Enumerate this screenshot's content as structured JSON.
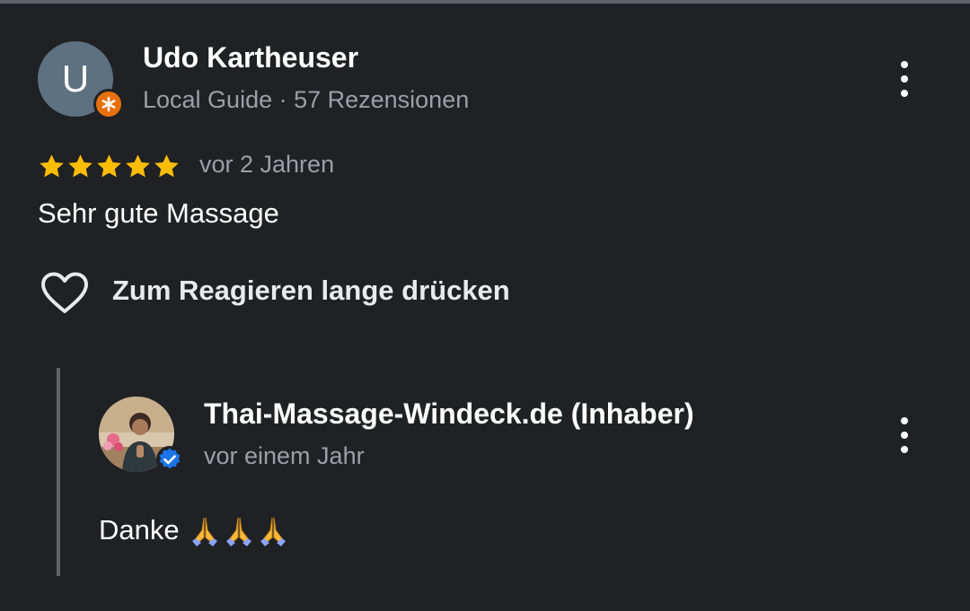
{
  "review": {
    "author_initial": "U",
    "author_name": "Udo Kartheuser",
    "author_meta": "Local Guide · 57 Rezensionen",
    "rating": 5,
    "time_ago": "vor 2 Jahren",
    "text": "Sehr gute Massage",
    "react_label": "Zum Reagieren lange drücken"
  },
  "owner_reply": {
    "name": "Thai-Massage-Windeck.de (Inhaber)",
    "time_ago": "vor einem Jahr",
    "text": "Danke"
  },
  "icons": {
    "more": "more-vert-icon",
    "star": "star-icon",
    "heart": "heart-outline-icon",
    "guide_badge": "local-guide-badge-icon",
    "verified": "verified-check-icon",
    "emoji": "folded-hands-emoji"
  },
  "colors": {
    "background": "#202124",
    "star": "#fbbc04",
    "guide_badge": "#e8700c",
    "verified": "#1a73e8",
    "secondary_text": "#9aa0a6"
  }
}
